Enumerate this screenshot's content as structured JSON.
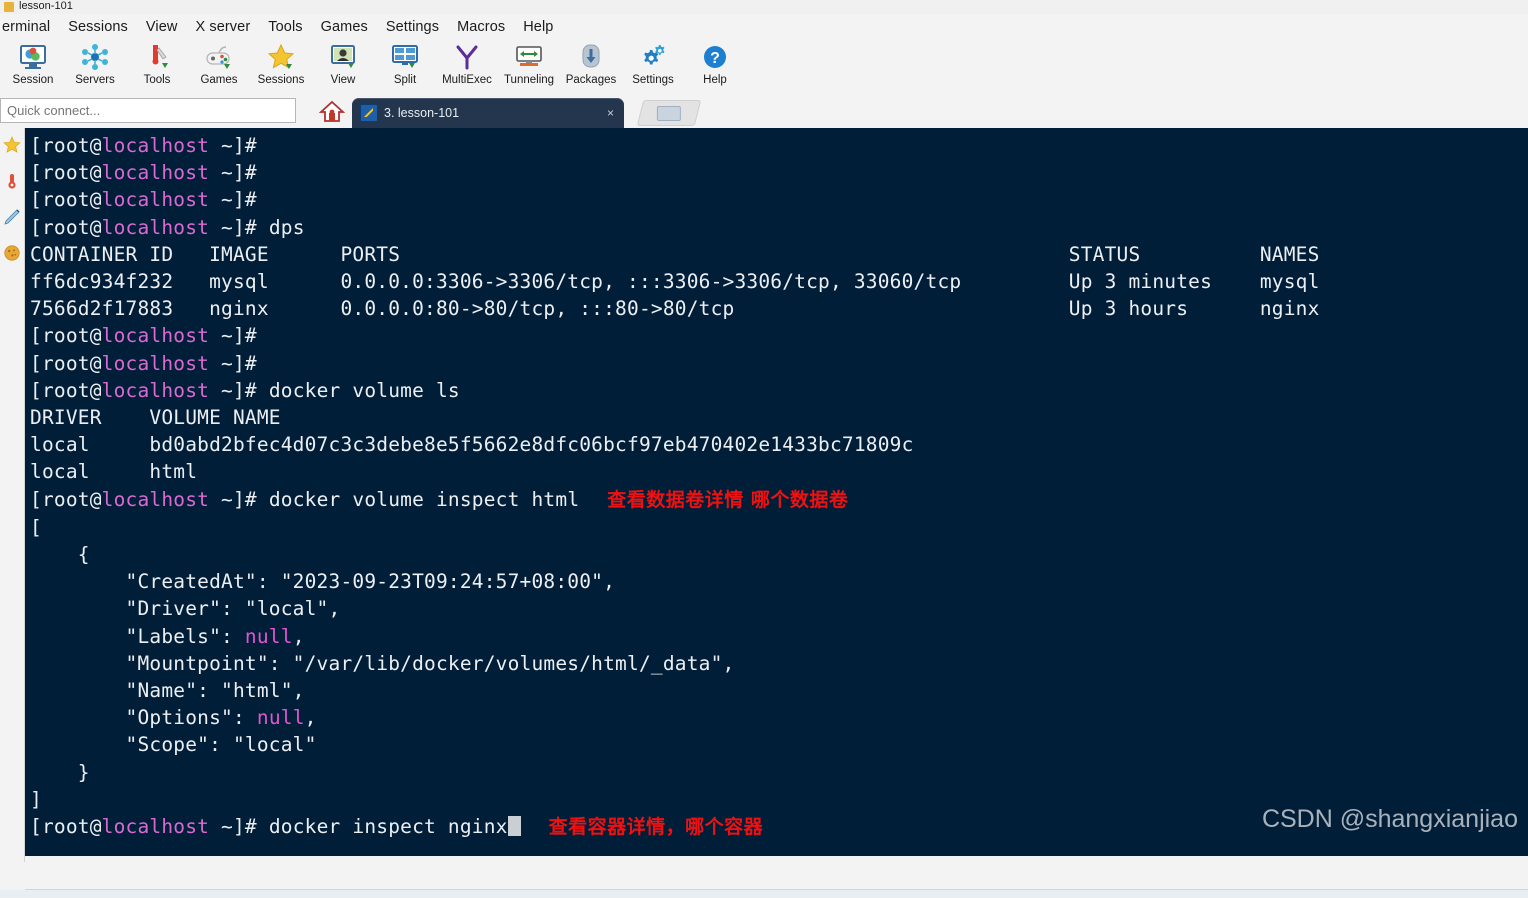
{
  "window": {
    "title": "lesson-101",
    "icon": "mobaxterm-icon"
  },
  "menubar": {
    "items": [
      {
        "label": "erminal",
        "name": "menu-terminal"
      },
      {
        "label": "Sessions",
        "name": "menu-sessions"
      },
      {
        "label": "View",
        "name": "menu-view"
      },
      {
        "label": "X server",
        "name": "menu-xserver"
      },
      {
        "label": "Tools",
        "name": "menu-tools"
      },
      {
        "label": "Games",
        "name": "menu-games"
      },
      {
        "label": "Settings",
        "name": "menu-settings"
      },
      {
        "label": "Macros",
        "name": "menu-macros"
      },
      {
        "label": "Help",
        "name": "menu-help"
      }
    ]
  },
  "toolbar": {
    "buttons": [
      {
        "label": "Session",
        "icon": "session-icon"
      },
      {
        "label": "Servers",
        "icon": "servers-icon"
      },
      {
        "label": "Tools",
        "icon": "tools-icon"
      },
      {
        "label": "Games",
        "icon": "games-icon"
      },
      {
        "label": "Sessions",
        "icon": "star-icon"
      },
      {
        "label": "View",
        "icon": "view-icon"
      },
      {
        "label": "Split",
        "icon": "split-icon"
      },
      {
        "label": "MultiExec",
        "icon": "multiexec-icon"
      },
      {
        "label": "Tunneling",
        "icon": "tunneling-icon"
      },
      {
        "label": "Packages",
        "icon": "packages-icon"
      },
      {
        "label": "Settings",
        "icon": "settings-gear-icon"
      },
      {
        "label": "Help",
        "icon": "help-question-icon"
      }
    ]
  },
  "quick_connect": {
    "placeholder": "Quick connect...",
    "value": ""
  },
  "tabs": {
    "home_icon": "home-icon",
    "items": [
      {
        "label": "3. lesson-101",
        "close": "×",
        "active": true
      }
    ],
    "new_tab_label": ""
  },
  "sidebar_rail": {
    "icons": [
      "star-icon",
      "thermometer-icon",
      "macro-pen-icon",
      "cookie-sftp-icon"
    ]
  },
  "terminal": {
    "colors": {
      "background": "#011e38",
      "foreground": "#e6eaee",
      "host": "#d96ad1",
      "null_keyword": "#e255cf",
      "annotation": "#ee1111",
      "cursor": "#c9cfd5"
    },
    "prompt": {
      "user": "[root@",
      "host": "localhost",
      "tail": " ~]#"
    },
    "lines": [
      {
        "type": "prompt",
        "cmd": ""
      },
      {
        "type": "prompt",
        "cmd": ""
      },
      {
        "type": "prompt",
        "cmd": ""
      },
      {
        "type": "prompt",
        "cmd": " dps"
      },
      {
        "type": "text",
        "text": "CONTAINER ID   IMAGE      PORTS                                                        STATUS          NAMES"
      },
      {
        "type": "text",
        "text": "ff6dc934f232   mysql      0.0.0.0:3306->3306/tcp, :::3306->3306/tcp, 33060/tcp         Up 3 minutes    mysql"
      },
      {
        "type": "text",
        "text": "7566d2f17883   nginx      0.0.0.0:80->80/tcp, :::80->80/tcp                            Up 3 hours      nginx"
      },
      {
        "type": "prompt",
        "cmd": ""
      },
      {
        "type": "prompt",
        "cmd": ""
      },
      {
        "type": "prompt",
        "cmd": " docker volume ls"
      },
      {
        "type": "text",
        "text": "DRIVER    VOLUME NAME"
      },
      {
        "type": "text",
        "text": "local     bd0abd2bfec4d07c3c3debe8e5f5662e8dfc06bcf97eb470402e1433bc71809c"
      },
      {
        "type": "text",
        "text": "local     html"
      },
      {
        "type": "prompt",
        "cmd": " docker volume inspect html",
        "annotation": "查看数据卷详情 哪个数据卷"
      },
      {
        "type": "text",
        "text": "["
      },
      {
        "type": "text",
        "text": "    {"
      },
      {
        "type": "text",
        "text": "        \"CreatedAt\": \"2023-09-23T09:24:57+08:00\","
      },
      {
        "type": "text",
        "text": "        \"Driver\": \"local\","
      },
      {
        "type": "kv_null",
        "key": "        \"Labels\": ",
        "nullword": "null",
        "tail": ","
      },
      {
        "type": "text",
        "text": "        \"Mountpoint\": \"/var/lib/docker/volumes/html/_data\","
      },
      {
        "type": "text",
        "text": "        \"Name\": \"html\","
      },
      {
        "type": "kv_null",
        "key": "        \"Options\": ",
        "nullword": "null",
        "tail": ","
      },
      {
        "type": "text",
        "text": "        \"Scope\": \"local\""
      },
      {
        "type": "text",
        "text": "    }"
      },
      {
        "type": "text",
        "text": "]"
      },
      {
        "type": "prompt",
        "cmd": " docker inspect nginx",
        "cursor": true,
        "annotation": "查看容器详情，哪个容器"
      }
    ]
  },
  "watermark": {
    "text": "CSDN @shangxianjiao"
  }
}
